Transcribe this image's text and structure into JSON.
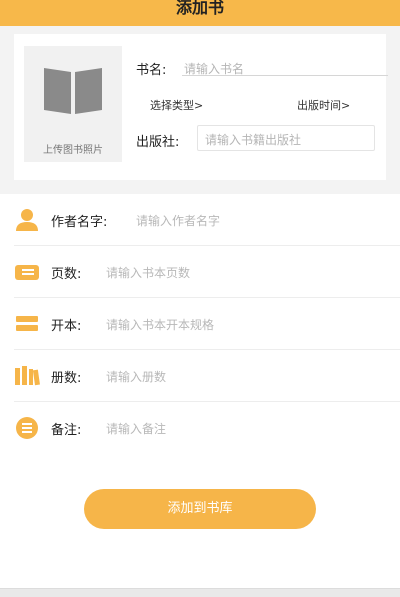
{
  "header": {
    "title": "添加书"
  },
  "card": {
    "photo_label": "上传图书照片",
    "name_label": "书名:",
    "name_placeholder": "请输入书名",
    "type_select": "选择类型>",
    "date_select": "出版时间>",
    "publisher_label": "出版社:",
    "publisher_placeholder": "请输入书籍出版社"
  },
  "fields": [
    {
      "label": "作者名字:",
      "placeholder": "请输入作者名字",
      "icon": "person-icon"
    },
    {
      "label": "页数:",
      "placeholder": "请输入书本页数",
      "icon": "pages-icon"
    },
    {
      "label": "开本:",
      "placeholder": "请输入书本开本规格",
      "icon": "format-icon"
    },
    {
      "label": "册数:",
      "placeholder": "请输入册数",
      "icon": "volumes-icon"
    },
    {
      "label": "备注:",
      "placeholder": "请输入备注",
      "icon": "notes-icon"
    }
  ],
  "actions": {
    "add_label": "添加到书库"
  },
  "colors": {
    "accent": "#f7b84a",
    "button": "#f6b549",
    "placeholder": "#b5b5b5"
  }
}
